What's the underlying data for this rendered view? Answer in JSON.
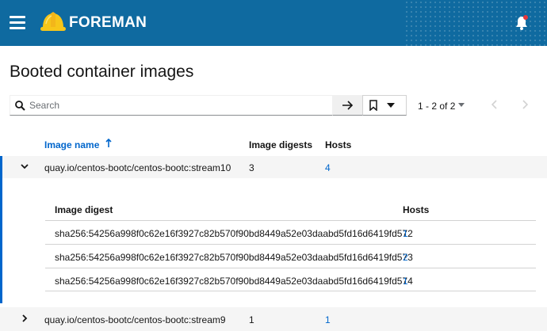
{
  "header": {
    "brand": "FOREMAN",
    "colors": {
      "masthead": "#0f6aa0",
      "notification_dot": "#e8363b",
      "link": "#0066cc"
    }
  },
  "page": {
    "title": "Booted container images"
  },
  "toolbar": {
    "search_placeholder": "Search",
    "pagination": "1 - 2 of 2"
  },
  "table": {
    "columns": {
      "image_name": "Image name",
      "image_digests": "Image digests",
      "hosts": "Hosts"
    },
    "rows": [
      {
        "image_name": "quay.io/centos-bootc/centos-bootc:stream10",
        "image_digests": "3",
        "hosts": "4",
        "expanded": true,
        "nested": {
          "columns": {
            "image_digest": "Image digest",
            "hosts": "Hosts"
          },
          "rows": [
            {
              "digest": "sha256:54256a998f0c62e16f3927c82b570f90bd8449a52e03daabd5fd16d6419fd572",
              "hosts": "1"
            },
            {
              "digest": "sha256:54256a998f0c62e16f3927c82b570f90bd8449a52e03daabd5fd16d6419fd573",
              "hosts": "2"
            },
            {
              "digest": "sha256:54256a998f0c62e16f3927c82b570f90bd8449a52e03daabd5fd16d6419fd574",
              "hosts": "1"
            }
          ]
        }
      },
      {
        "image_name": "quay.io/centos-bootc/centos-bootc:stream9",
        "image_digests": "1",
        "hosts": "1",
        "expanded": false
      }
    ]
  }
}
